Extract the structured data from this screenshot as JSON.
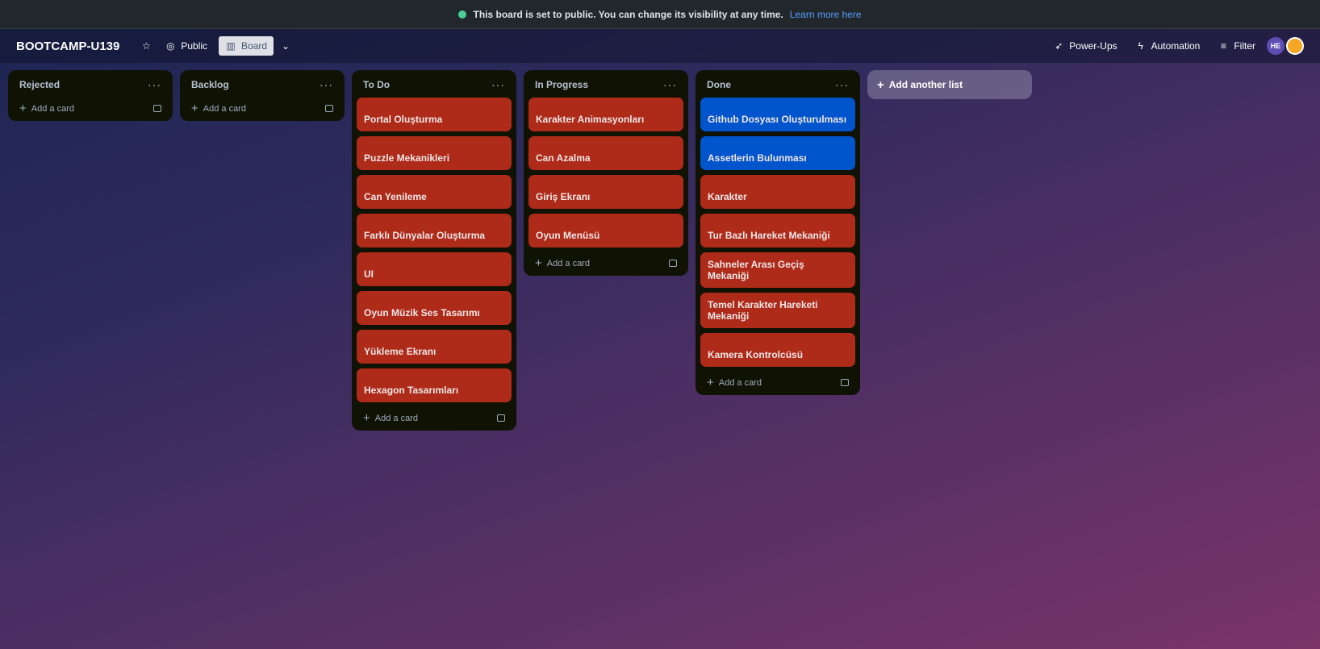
{
  "banner": {
    "message": "This board is set to public. You can change its visibility at any time.",
    "link": "Learn more here"
  },
  "boardbar": {
    "title": "BOOTCAMP-U139",
    "visibility": "Public",
    "view": "Board",
    "powerups": "Power-Ups",
    "automation": "Automation",
    "filter": "Filter",
    "avatar_initials": "HE"
  },
  "lists": [
    {
      "title": "Rejected",
      "cards": [],
      "add_label": "Add a card"
    },
    {
      "title": "Backlog",
      "cards": [],
      "add_label": "Add a card"
    },
    {
      "title": "To Do",
      "add_label": "Add a card",
      "cards": [
        {
          "title": "Portal Oluşturma",
          "color": "red"
        },
        {
          "title": "Puzzle Mekanikleri",
          "color": "red"
        },
        {
          "title": "Can Yenileme",
          "color": "red"
        },
        {
          "title": "Farklı Dünyalar Oluşturma",
          "color": "red"
        },
        {
          "title": "UI",
          "color": "red"
        },
        {
          "title": "Oyun Müzik Ses Tasarımı",
          "color": "red"
        },
        {
          "title": "Yükleme Ekranı",
          "color": "red"
        },
        {
          "title": "Hexagon Tasarımları",
          "color": "red"
        }
      ]
    },
    {
      "title": "In Progress",
      "add_label": "Add a card",
      "cards": [
        {
          "title": "Karakter Animasyonları",
          "color": "red"
        },
        {
          "title": "Can Azalma",
          "color": "red"
        },
        {
          "title": "Giriş Ekranı",
          "color": "red"
        },
        {
          "title": "Oyun Menüsü",
          "color": "red"
        }
      ]
    },
    {
      "title": "Done",
      "add_label": "Add a card",
      "cards": [
        {
          "title": "Github Dosyası Oluşturulması",
          "color": "blue"
        },
        {
          "title": "Assetlerin Bulunması",
          "color": "blue"
        },
        {
          "title": "Karakter",
          "color": "red"
        },
        {
          "title": "Tur Bazlı Hareket Mekaniği",
          "color": "red"
        },
        {
          "title": "Sahneler Arası Geçiş Mekaniği",
          "color": "red"
        },
        {
          "title": "Temel Karakter Hareketi Mekaniği",
          "color": "red"
        },
        {
          "title": "Kamera Kontrolcüsü",
          "color": "red"
        }
      ]
    }
  ],
  "add_list_label": "Add another list",
  "colors": {
    "red": "#ae2a19",
    "blue": "#0055cc",
    "list_bg": "#101204"
  }
}
